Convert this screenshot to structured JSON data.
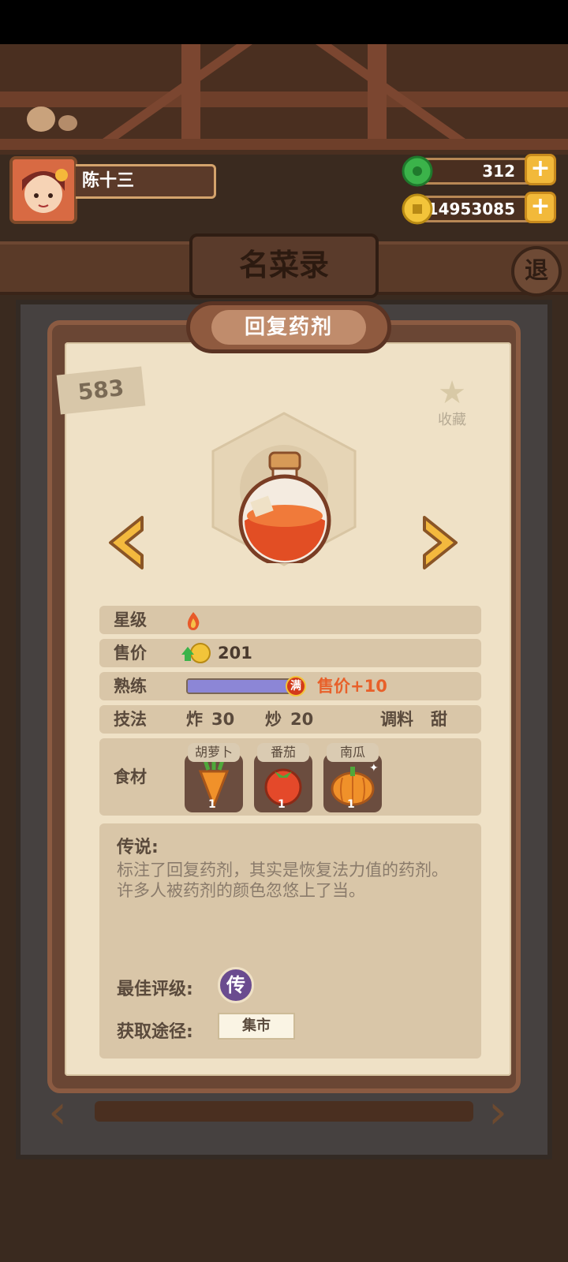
{
  "player": {
    "name": "陈十三"
  },
  "currencies": {
    "jade": "312",
    "coins": "14953085",
    "add_label": "+"
  },
  "page": {
    "title": "名菜录",
    "exit_label": "退"
  },
  "dish": {
    "name": "回复药剂",
    "number": "583",
    "favorite_label": "收藏",
    "stats": {
      "star_label": "星级",
      "price_label": "售价",
      "price_value": "201",
      "proficiency_label": "熟练",
      "proficiency_fraction": 1.0,
      "proficiency_badge": "满",
      "proficiency_bonus": "售价+10",
      "technique_label": "技法",
      "fry_label": "炸",
      "fry_value": "30",
      "stirfry_label": "炒",
      "stirfry_value": "20",
      "seasoning_label": "调料",
      "seasoning_value": "甜"
    },
    "ingredients_label": "食材",
    "ingredients": [
      {
        "name": "胡萝卜",
        "count": "1",
        "icon": "carrot-icon"
      },
      {
        "name": "番茄",
        "count": "1",
        "icon": "tomato-icon"
      },
      {
        "name": "南瓜",
        "count": "1",
        "icon": "pumpkin-icon"
      }
    ],
    "legend_title": "传说:",
    "legend_text": "标注了回复药剂，其实是恢复法力值的药剂。许多人被药剂的颜色忽悠上了当。",
    "best_rating_label": "最佳评级:",
    "best_rating_value": "传",
    "source_label": "获取途径:",
    "source_value": "集市"
  },
  "colors": {
    "accent": "#e8602a",
    "progress": "#8c86d6",
    "rating": "#6a4b8f"
  }
}
